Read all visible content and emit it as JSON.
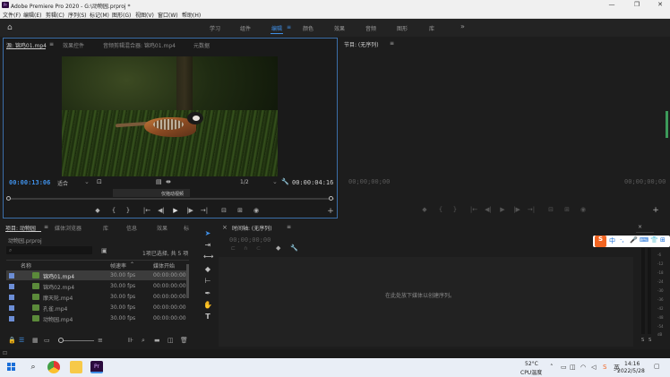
{
  "window": {
    "title": "Adobe Premiere Pro 2020 - G:\\动物园.prproj *",
    "controls": [
      "—",
      "❐",
      "✕"
    ]
  },
  "menu": [
    "文件(F)",
    "编辑(E)",
    "剪辑(C)",
    "序列(S)",
    "标记(M)",
    "图形(G)",
    "视图(V)",
    "窗口(W)",
    "帮助(H)"
  ],
  "workspaces": {
    "items": [
      "学习",
      "组件",
      "编辑",
      "颜色",
      "效果",
      "音频",
      "图形",
      "库"
    ],
    "active": "编辑",
    "more": "»"
  },
  "source": {
    "tabs": [
      "源: 锦鸡01.mp4",
      "效果控件",
      "音频剪辑混合器: 锦鸡01.mp4",
      "元数据"
    ],
    "current_tc": "00:00:13:06",
    "fit": "适合",
    "ratio": "1/2",
    "duration_tc": "00:00:04:16",
    "drag_tip": "仅拖动视频",
    "controls": [
      "◆",
      "{",
      "}",
      "|←",
      "◀|",
      "▶",
      "|▶",
      "→|",
      "⊟",
      "⊞",
      "◉",
      "+"
    ]
  },
  "program": {
    "title": "节目: (无序列)",
    "tc_left": "00;00;00;00",
    "tc_right": "00;00;00;00",
    "controls": [
      "◆",
      "{",
      "}",
      "|←",
      "◀|",
      "▶",
      "|▶",
      "→|",
      "⊟",
      "⊞",
      "◉",
      "+"
    ]
  },
  "project": {
    "tabs": [
      "项目: 动物园",
      "媒体浏览器",
      "库",
      "信息",
      "效果",
      "标"
    ],
    "filename": "动物园.prproj",
    "selection": "1项已选择, 共 5 项",
    "columns": [
      "名称",
      "帧速率",
      "媒体开始"
    ],
    "rows": [
      {
        "name": "锦鸡01.mp4",
        "fps": "30.00 fps",
        "start": "00:00:00:00",
        "selected": true
      },
      {
        "name": "锦鸡02.mp4",
        "fps": "30.00 fps",
        "start": "00:00:00:00",
        "selected": false
      },
      {
        "name": "摩天轮.mp4",
        "fps": "30.00 fps",
        "start": "00:00:00:00",
        "selected": false
      },
      {
        "name": "孔雀.mp4",
        "fps": "30.00 fps",
        "start": "00:00:00:00",
        "selected": false
      },
      {
        "name": "动物园.mp4",
        "fps": "30.00 fps",
        "start": "00:00:00:00",
        "selected": false
      }
    ]
  },
  "timeline": {
    "title": "时间轴: (无序列)",
    "tc": "00;00;00;00",
    "empty_hint": "在此处放下媒体以创建序列。"
  },
  "meter": {
    "ticks": [
      "-6",
      "-12",
      "-18",
      "-24",
      "-30",
      "-36",
      "-42",
      "-48",
      "-54",
      "dB"
    ],
    "solo": "S",
    "solo2": "S"
  },
  "ime": {
    "items": [
      "中",
      "·,",
      "🎤",
      "⌨",
      "👕",
      "⊞"
    ]
  },
  "taskbar": {
    "weather_temp": "52°C",
    "weather_label": "CPU温度",
    "time": "14:16",
    "date": "2022/5/28"
  },
  "colors": {
    "accent": "#3f8fe6",
    "panel_bg": "#1d1d1d",
    "taskbar_bg": "#e9eef6"
  }
}
